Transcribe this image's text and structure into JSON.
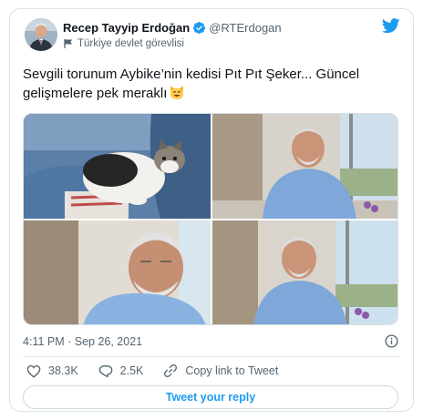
{
  "author": {
    "display_name": "Recep Tayyip Erdoğan",
    "handle": "@RTErdogan",
    "label": "Türkiye devlet görevlisi"
  },
  "tweet": {
    "text": "Sevgili torunum Aybike’nin kedisi Pıt Pıt Şeker... Güncel gelişmelere pek meraklı",
    "emoji": "smiling-cat-emoji",
    "timestamp": "4:11 PM · Sep 26, 2021"
  },
  "stats": {
    "likes": "38.3K",
    "replies": "2.5K",
    "copy_link_label": "Copy link to Tweet"
  },
  "reply_button_label": "Tweet your reply",
  "colors": {
    "accent": "#1d9bf0",
    "text": "#0f1419",
    "secondary": "#536471",
    "border": "#d8e0e6"
  }
}
